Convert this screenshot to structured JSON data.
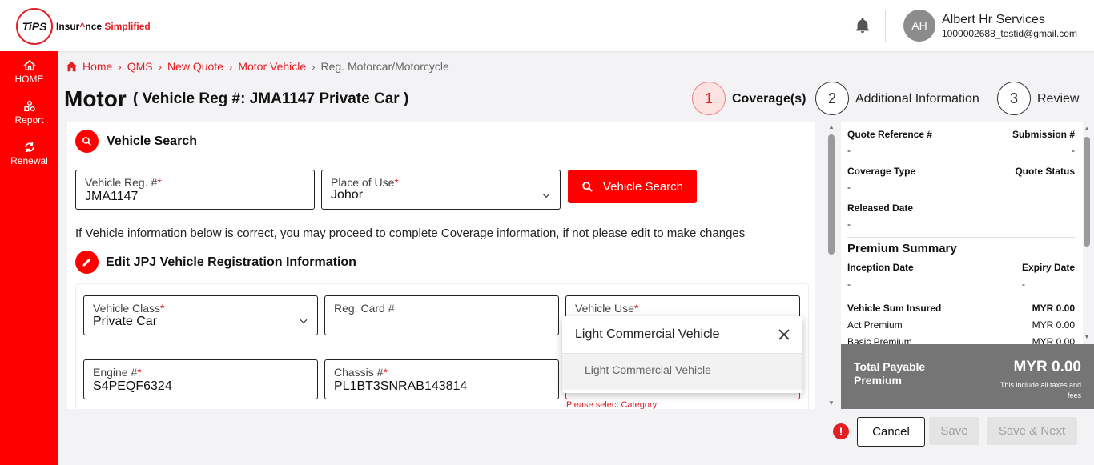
{
  "header": {
    "logo_mark": "TiPS",
    "logo_text_a": "Insur",
    "logo_text_b": "nce",
    "logo_text_c": "Simplified",
    "avatar_initials": "AH",
    "user_name": "Albert Hr Services",
    "user_email": "1000002688_testid@gmail.com"
  },
  "sidebar": {
    "items": [
      {
        "label": "HOME",
        "icon": "home-icon"
      },
      {
        "label": "Report",
        "icon": "report-icon"
      },
      {
        "label": "Renewal",
        "icon": "renewal-icon"
      }
    ]
  },
  "breadcrumb": [
    "Home",
    "QMS",
    "New Quote",
    "Motor Vehicle",
    "Reg. Motorcar/Motorcycle"
  ],
  "page": {
    "title": "Motor",
    "subtitle": "( Vehicle Reg #: JMA1147 Private Car )"
  },
  "steps": [
    {
      "num": "1",
      "label": "Coverage(s)",
      "active": true
    },
    {
      "num": "2",
      "label": "Additional Information",
      "active": false
    },
    {
      "num": "3",
      "label": "Review",
      "active": false
    }
  ],
  "vehicle_search": {
    "title": "Vehicle Search",
    "reg_label": "Vehicle Reg. #",
    "reg_value": "JMA1147",
    "place_label": "Place of Use",
    "place_value": "Johor",
    "button_label": "Vehicle Search",
    "required_mark": "*"
  },
  "info_text": "If Vehicle information below is correct, you may proceed to complete Coverage information, if not please edit to make changes",
  "jpj": {
    "title": "Edit JPJ Vehicle Registration Information",
    "class_label": "Vehicle Class",
    "class_value": "Private Car",
    "regcard_label": "Reg. Card #",
    "regcard_value": "",
    "use_label": "Vehicle Use",
    "engine_label": "Engine #",
    "engine_value": "S4PEQF6324",
    "chassis_label": "Chassis #",
    "chassis_value": "PL1BT3SNRAB143814",
    "error_text": "Please select Category"
  },
  "dropdown": {
    "header": "Light Commercial Vehicle",
    "option": "Light Commercial Vehicle"
  },
  "summary": {
    "quote_ref_label": "Quote Reference #",
    "quote_ref_value": "-",
    "submission_label": "Submission #",
    "submission_value": "-",
    "coverage_type_label": "Coverage Type",
    "coverage_type_value": "-",
    "quote_status_label": "Quote Status",
    "released_label": "Released Date",
    "released_value": "-",
    "premium_title": "Premium Summary",
    "inception_label": "Inception Date",
    "inception_value": "-",
    "expiry_label": "Expiry Date",
    "expiry_value": "-",
    "sum_insured_label": "Vehicle Sum Insured",
    "sum_insured_value": "MYR 0.00",
    "act_label": "Act Premium",
    "act_value": "MYR 0.00",
    "basic_label": "Basic Premium",
    "basic_value": "MYR 0.00"
  },
  "total": {
    "label": "Total Payable Premium",
    "amount": "MYR 0.00",
    "note": "This include all taxes and fees"
  },
  "actions": {
    "warning": "!",
    "cancel": "Cancel",
    "save": "Save",
    "save_next": "Save & Next"
  },
  "colors": {
    "brand_red": "#ff0000",
    "active_step_bg": "#fde2e2",
    "total_bg": "#757575"
  }
}
